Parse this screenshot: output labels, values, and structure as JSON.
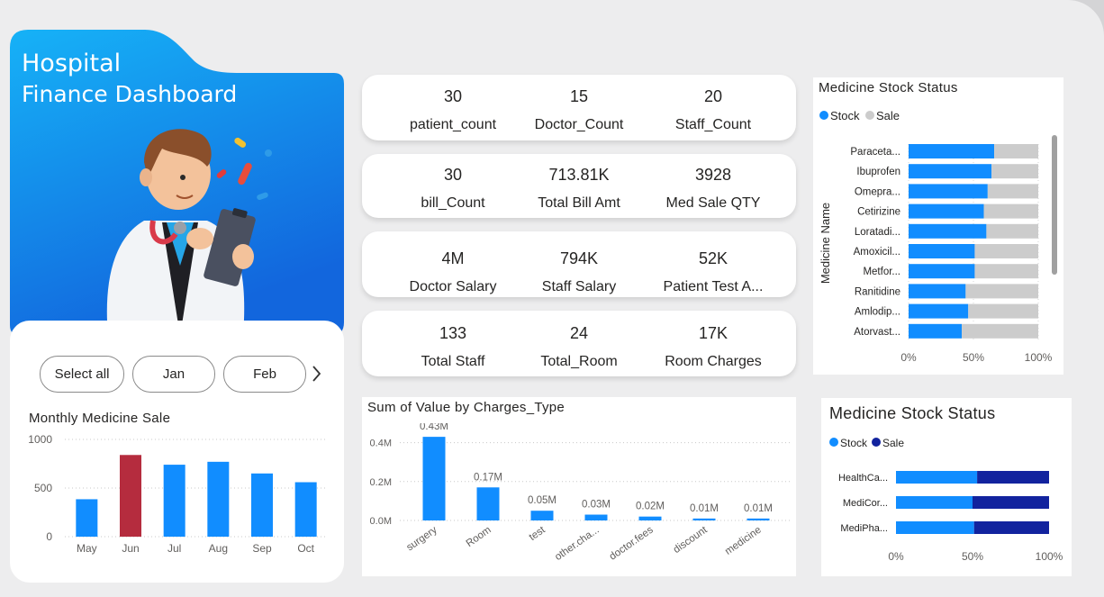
{
  "header": {
    "title_line1": "Hospital",
    "title_line2": "Finance Dashboard"
  },
  "slicer": {
    "items": [
      "Select all",
      "Jan",
      "Feb"
    ],
    "next_icon": "chevron-right-icon"
  },
  "kpi_rows": [
    [
      {
        "value": "30",
        "label": "patient_count"
      },
      {
        "value": "15",
        "label": "Doctor_Count"
      },
      {
        "value": "20",
        "label": "Staff_Count"
      }
    ],
    [
      {
        "value": "30",
        "label": "bill_Count"
      },
      {
        "value": "713.81K",
        "label": "Total Bill Amt"
      },
      {
        "value": "3928",
        "label": "Med Sale QTY"
      }
    ],
    [
      {
        "value": "4M",
        "label": "Doctor Salary"
      },
      {
        "value": "794K",
        "label": "Staff Salary"
      },
      {
        "value": "52K",
        "label": "Patient Test A..."
      }
    ],
    [
      {
        "value": "133",
        "label": "Total Staff"
      },
      {
        "value": "24",
        "label": "Total_Room"
      },
      {
        "value": "17K",
        "label": "Room Charges"
      }
    ]
  ],
  "colors": {
    "accent_blue": "#118dff",
    "highlight_red": "#b52c3e",
    "sale_gray": "#cccccc",
    "navy": "#12239e",
    "banner_top": "#13a7f5",
    "banner_bottom": "#1370e0"
  },
  "chart_data": [
    {
      "type": "bar",
      "title": "Monthly Medicine Sale",
      "categories": [
        "May",
        "Jun",
        "Jul",
        "Aug",
        "Sep",
        "Oct"
      ],
      "values": [
        385,
        840,
        740,
        770,
        650,
        560
      ],
      "highlight_index": 1,
      "ylim": [
        0,
        1000
      ],
      "yticks": [
        "0",
        "500",
        "1000"
      ],
      "grid": true
    },
    {
      "type": "bar",
      "title": "Sum of Value by Charges_Type",
      "categories": [
        "surgery",
        "Room",
        "test",
        "other.cha...",
        "doctor.fees",
        "discount",
        "medicine"
      ],
      "values": [
        0.43,
        0.17,
        0.05,
        0.03,
        0.02,
        0.01,
        0.01
      ],
      "data_labels": [
        "0.43M",
        "0.17M",
        "0.05M",
        "0.03M",
        "0.02M",
        "0.01M",
        "0.01M"
      ],
      "ylim": [
        0,
        0.5
      ],
      "yticks": [
        {
          "v": 0,
          "label": "0.0M"
        },
        {
          "v": 0.2,
          "label": "0.2M"
        },
        {
          "v": 0.4,
          "label": "0.4M"
        }
      ],
      "grid": true
    },
    {
      "type": "bar",
      "stacked_percent": true,
      "orientation": "horizontal",
      "title": "Medicine Stock Status",
      "ylabel": "Medicine Name",
      "legend": [
        "Stock",
        "Sale"
      ],
      "categories": [
        "Paraceta...",
        "Ibuprofen",
        "Omepra...",
        "Cetirizine",
        "Loratadi...",
        "Amoxicil...",
        "Metfor...",
        "Ranitidine",
        "Amlodip...",
        "Atorvast..."
      ],
      "series": [
        {
          "name": "Stock",
          "values": [
            66,
            64,
            61,
            58,
            60,
            51,
            51,
            44,
            46,
            41
          ]
        },
        {
          "name": "Sale",
          "values": [
            34,
            36,
            39,
            42,
            40,
            49,
            49,
            56,
            54,
            59
          ]
        }
      ],
      "xticks": [
        "0%",
        "50%",
        "100%"
      ]
    },
    {
      "type": "bar",
      "stacked_percent": true,
      "orientation": "horizontal",
      "title": "Medicine Stock Status",
      "legend": [
        "Stock",
        "Sale"
      ],
      "categories": [
        "HealthCa...",
        "MediCor...",
        "MediPha..."
      ],
      "series": [
        {
          "name": "Stock",
          "values": [
            53,
            50,
            51
          ]
        },
        {
          "name": "Sale",
          "values": [
            47,
            50,
            49
          ]
        }
      ],
      "xticks": [
        "0%",
        "50%",
        "100%"
      ]
    }
  ]
}
